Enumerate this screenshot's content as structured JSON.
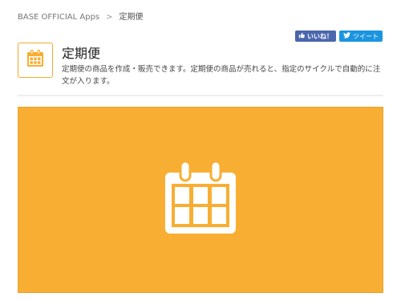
{
  "breadcrumb": {
    "parent": "BASE OFFICIAL Apps",
    "separator": ">",
    "current": "定期便"
  },
  "social": {
    "like_label": "いいね！",
    "tweet_label": "ツイート"
  },
  "app": {
    "title": "定期便",
    "description": "定期便の商品を作成・販売できます。定期便の商品が売れると、指定のサイクルで自動的に注文が入ります。",
    "icon": "calendar-icon",
    "accent_color": "#f8ae33"
  },
  "hero": {
    "icon": "calendar-icon",
    "background": "#f8ae33"
  }
}
